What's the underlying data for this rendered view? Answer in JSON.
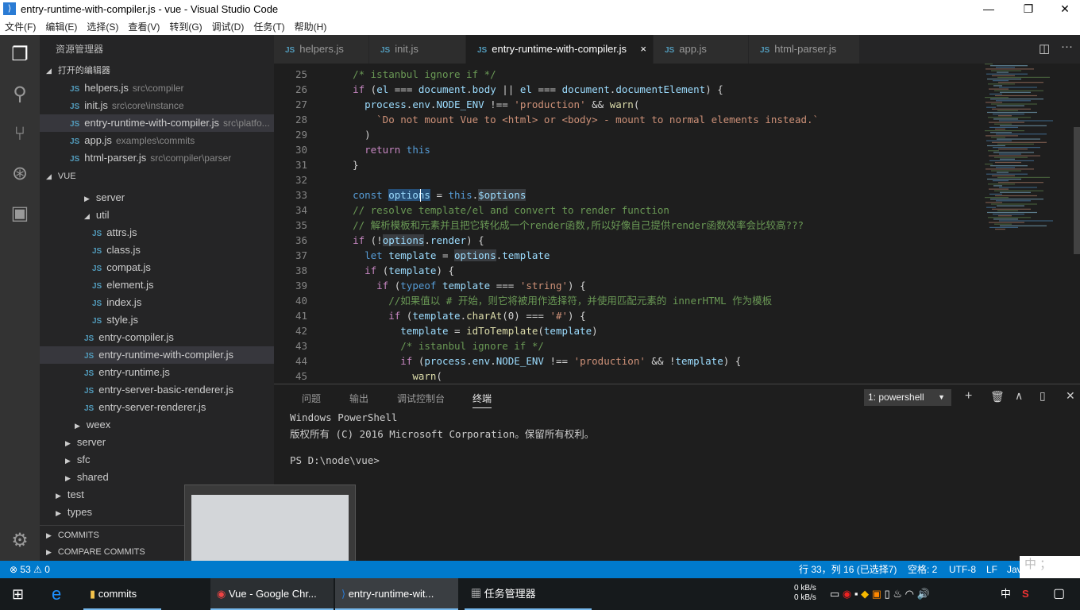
{
  "window": {
    "title": "entry-runtime-with-compiler.js - vue - Visual Studio Code",
    "logo": "VS Code logo",
    "minimize": "—",
    "restore": "❐",
    "close": "✕"
  },
  "menu": [
    "文件(F)",
    "编辑(E)",
    "选择(S)",
    "查看(V)",
    "转到(G)",
    "调试(D)",
    "任务(T)",
    "帮助(H)"
  ],
  "sidebar": {
    "title": "资源管理器",
    "open_editors_label": "打开的编辑器",
    "open_editors": [
      {
        "name": "helpers.js",
        "path": "src\\compiler"
      },
      {
        "name": "init.js",
        "path": "src\\core\\instance"
      },
      {
        "name": "entry-runtime-with-compiler.js",
        "path": "src\\platfo...",
        "selected": true
      },
      {
        "name": "app.js",
        "path": "examples\\commits"
      },
      {
        "name": "html-parser.js",
        "path": "src\\compiler\\parser"
      }
    ],
    "folder_label": "VUE",
    "tree": [
      {
        "name": "server",
        "type": "folder",
        "expanded": false,
        "depth": 2
      },
      {
        "name": "util",
        "type": "folder",
        "expanded": true,
        "depth": 2
      },
      {
        "name": "attrs.js",
        "type": "file",
        "depth": 3
      },
      {
        "name": "class.js",
        "type": "file",
        "depth": 3
      },
      {
        "name": "compat.js",
        "type": "file",
        "depth": 3
      },
      {
        "name": "element.js",
        "type": "file",
        "depth": 3
      },
      {
        "name": "index.js",
        "type": "file",
        "depth": 3
      },
      {
        "name": "style.js",
        "type": "file",
        "depth": 3
      },
      {
        "name": "entry-compiler.js",
        "type": "file",
        "depth": 2
      },
      {
        "name": "entry-runtime-with-compiler.js",
        "type": "file",
        "depth": 2,
        "selected": true
      },
      {
        "name": "entry-runtime.js",
        "type": "file",
        "depth": 2
      },
      {
        "name": "entry-server-basic-renderer.js",
        "type": "file",
        "depth": 2
      },
      {
        "name": "entry-server-renderer.js",
        "type": "file",
        "depth": 2
      },
      {
        "name": "weex",
        "type": "folder",
        "depth": 1
      },
      {
        "name": "server",
        "type": "folder",
        "depth": 0
      },
      {
        "name": "sfc",
        "type": "folder",
        "depth": 0
      },
      {
        "name": "shared",
        "type": "folder",
        "depth": 0
      },
      {
        "name": "test",
        "type": "folder",
        "depth": -1
      },
      {
        "name": "types",
        "type": "folder",
        "depth": -1
      }
    ],
    "commits_label": "COMMITS",
    "compare_label": "COMPARE COMMITS"
  },
  "tabs": [
    {
      "label": "helpers.js"
    },
    {
      "label": "init.js"
    },
    {
      "label": "entry-runtime-with-compiler.js",
      "active": true
    },
    {
      "label": "app.js"
    },
    {
      "label": "html-parser.js"
    }
  ],
  "tab_close": "×",
  "editor": {
    "lines": [
      {
        "n": 25,
        "t": [
          [
            "",
            "  "
          ],
          [
            "cm",
            "/* istanbul ignore if */"
          ]
        ]
      },
      {
        "n": 26,
        "t": [
          [
            "",
            "  "
          ],
          [
            "cf",
            "if"
          ],
          [
            "",
            " ("
          ],
          [
            "var",
            "el"
          ],
          [
            "",
            " === "
          ],
          [
            "var",
            "document"
          ],
          [
            "",
            "."
          ],
          [
            "var",
            "body"
          ],
          [
            "",
            " || "
          ],
          [
            "var",
            "el"
          ],
          [
            "",
            " === "
          ],
          [
            "var",
            "document"
          ],
          [
            "",
            "."
          ],
          [
            "var",
            "documentElement"
          ],
          [
            "",
            ") {"
          ]
        ]
      },
      {
        "n": 27,
        "t": [
          [
            "",
            "    "
          ],
          [
            "var",
            "process"
          ],
          [
            "",
            "."
          ],
          [
            "var",
            "env"
          ],
          [
            "",
            "."
          ],
          [
            "var",
            "NODE_ENV"
          ],
          [
            "",
            " !== "
          ],
          [
            "str",
            "'production'"
          ],
          [
            "",
            " && "
          ],
          [
            "fn",
            "warn"
          ],
          [
            "",
            "("
          ]
        ]
      },
      {
        "n": 28,
        "t": [
          [
            "",
            "      "
          ],
          [
            "str",
            "`Do not mount Vue to <html> or <body> - mount to normal elements instead.`"
          ]
        ]
      },
      {
        "n": 29,
        "t": [
          [
            "",
            "    )"
          ]
        ]
      },
      {
        "n": 30,
        "t": [
          [
            "",
            "    "
          ],
          [
            "cf",
            "return"
          ],
          [
            "",
            " "
          ],
          [
            "kw",
            "this"
          ]
        ]
      },
      {
        "n": 31,
        "t": [
          [
            "",
            "  }"
          ]
        ]
      },
      {
        "n": 32,
        "t": []
      },
      {
        "n": 33,
        "t": [
          [
            "",
            "  "
          ],
          [
            "kw",
            "const"
          ],
          [
            "",
            " "
          ],
          [
            "var hs",
            "options"
          ],
          [
            "",
            " = "
          ],
          [
            "kw",
            "this"
          ],
          [
            "",
            "."
          ],
          [
            "var hl",
            "$options"
          ]
        ]
      },
      {
        "n": 34,
        "t": [
          [
            "",
            "  "
          ],
          [
            "cm",
            "// resolve template/el and convert to render function"
          ]
        ]
      },
      {
        "n": 35,
        "t": [
          [
            "",
            "  "
          ],
          [
            "cm",
            "// 解析模板和元素并且把它转化成一个render函数,所以好像自己提供render函数效率会比较高???"
          ]
        ]
      },
      {
        "n": 36,
        "t": [
          [
            "",
            "  "
          ],
          [
            "cf",
            "if"
          ],
          [
            "",
            " (!"
          ],
          [
            "var hl",
            "options"
          ],
          [
            "",
            "."
          ],
          [
            "var",
            "render"
          ],
          [
            "",
            ") {"
          ]
        ]
      },
      {
        "n": 37,
        "t": [
          [
            "",
            "    "
          ],
          [
            "kw",
            "let"
          ],
          [
            "",
            " "
          ],
          [
            "var",
            "template"
          ],
          [
            "",
            " = "
          ],
          [
            "var hl",
            "options"
          ],
          [
            "",
            "."
          ],
          [
            "var",
            "template"
          ]
        ]
      },
      {
        "n": 38,
        "t": [
          [
            "",
            "    "
          ],
          [
            "cf",
            "if"
          ],
          [
            "",
            " ("
          ],
          [
            "var",
            "template"
          ],
          [
            "",
            ") {"
          ]
        ]
      },
      {
        "n": 39,
        "t": [
          [
            "",
            "      "
          ],
          [
            "cf",
            "if"
          ],
          [
            "",
            " ("
          ],
          [
            "kw",
            "typeof"
          ],
          [
            "",
            " "
          ],
          [
            "var",
            "template"
          ],
          [
            "",
            " === "
          ],
          [
            "str",
            "'string'"
          ],
          [
            "",
            ") {"
          ]
        ]
      },
      {
        "n": 40,
        "t": [
          [
            "",
            "        "
          ],
          [
            "cm",
            "//如果值以 # 开始，则它将被用作选择符，并使用匹配元素的 innerHTML 作为模板"
          ]
        ]
      },
      {
        "n": 41,
        "t": [
          [
            "",
            "        "
          ],
          [
            "cf",
            "if"
          ],
          [
            "",
            " ("
          ],
          [
            "var",
            "template"
          ],
          [
            "",
            "."
          ],
          [
            "fn",
            "charAt"
          ],
          [
            "",
            "(0) === "
          ],
          [
            "str",
            "'#'"
          ],
          [
            "",
            ") {"
          ]
        ]
      },
      {
        "n": 42,
        "t": [
          [
            "",
            "          "
          ],
          [
            "var",
            "template"
          ],
          [
            "",
            " = "
          ],
          [
            "fn",
            "idToTemplate"
          ],
          [
            "",
            "("
          ],
          [
            "var",
            "template"
          ],
          [
            "",
            ")"
          ]
        ]
      },
      {
        "n": 43,
        "t": [
          [
            "",
            "          "
          ],
          [
            "cm",
            "/* istanbul ignore if */"
          ]
        ]
      },
      {
        "n": 44,
        "t": [
          [
            "",
            "          "
          ],
          [
            "cf",
            "if"
          ],
          [
            "",
            " ("
          ],
          [
            "var",
            "process"
          ],
          [
            "",
            "."
          ],
          [
            "var",
            "env"
          ],
          [
            "",
            "."
          ],
          [
            "var",
            "NODE_ENV"
          ],
          [
            "",
            " !== "
          ],
          [
            "str",
            "'production'"
          ],
          [
            "",
            " && !"
          ],
          [
            "var",
            "template"
          ],
          [
            "",
            ") {"
          ]
        ]
      },
      {
        "n": 45,
        "t": [
          [
            "",
            "            "
          ],
          [
            "fn",
            "warn"
          ],
          [
            "",
            "("
          ]
        ]
      }
    ]
  },
  "panel": {
    "tabs": [
      "问题",
      "输出",
      "调试控制台",
      "终端"
    ],
    "active_tab": "终端",
    "terminal_select": "1: powershell",
    "terminal_lines": [
      "Windows PowerShell",
      "版权所有 (C) 2016 Microsoft Corporation。保留所有权利。",
      "",
      "PS D:\\node\\vue>"
    ]
  },
  "statusbar": {
    "errors": "53",
    "warnings": "0",
    "position": "行 33，列 16 (已选择7)",
    "spaces": "空格: 2",
    "encoding": "UTF-8",
    "eol": "LF",
    "language": "Jav",
    "ime": "中 ；"
  },
  "taskbar": {
    "items": [
      "commits",
      "Vue - Google Chr...",
      "entry-runtime-wit...",
      "任务管理器"
    ],
    "net_up": "0 kB/s",
    "net_down": "0 kB/s",
    "ime": "中"
  },
  "colors": {
    "accent": "#007acc",
    "editor_bg": "#1e1e1e",
    "sidebar_bg": "#252526"
  }
}
